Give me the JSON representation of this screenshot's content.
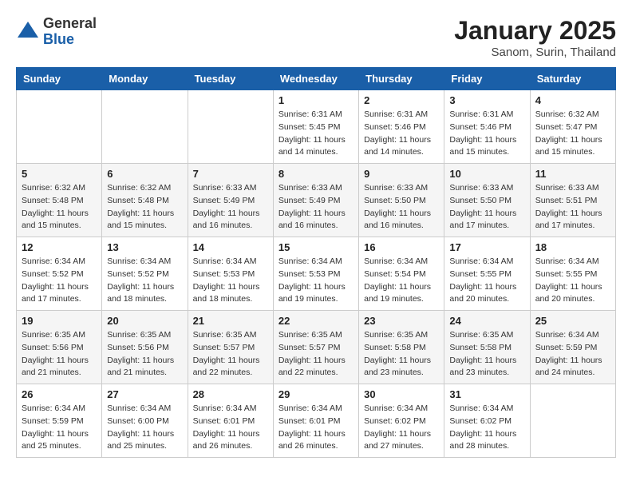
{
  "logo": {
    "general": "General",
    "blue": "Blue"
  },
  "header": {
    "month": "January 2025",
    "location": "Sanom, Surin, Thailand"
  },
  "weekdays": [
    "Sunday",
    "Monday",
    "Tuesday",
    "Wednesday",
    "Thursday",
    "Friday",
    "Saturday"
  ],
  "weeks": [
    [
      {
        "day": "",
        "info": ""
      },
      {
        "day": "",
        "info": ""
      },
      {
        "day": "",
        "info": ""
      },
      {
        "day": "1",
        "info": "Sunrise: 6:31 AM\nSunset: 5:45 PM\nDaylight: 11 hours and 14 minutes."
      },
      {
        "day": "2",
        "info": "Sunrise: 6:31 AM\nSunset: 5:46 PM\nDaylight: 11 hours and 14 minutes."
      },
      {
        "day": "3",
        "info": "Sunrise: 6:31 AM\nSunset: 5:46 PM\nDaylight: 11 hours and 15 minutes."
      },
      {
        "day": "4",
        "info": "Sunrise: 6:32 AM\nSunset: 5:47 PM\nDaylight: 11 hours and 15 minutes."
      }
    ],
    [
      {
        "day": "5",
        "info": "Sunrise: 6:32 AM\nSunset: 5:48 PM\nDaylight: 11 hours and 15 minutes."
      },
      {
        "day": "6",
        "info": "Sunrise: 6:32 AM\nSunset: 5:48 PM\nDaylight: 11 hours and 15 minutes."
      },
      {
        "day": "7",
        "info": "Sunrise: 6:33 AM\nSunset: 5:49 PM\nDaylight: 11 hours and 16 minutes."
      },
      {
        "day": "8",
        "info": "Sunrise: 6:33 AM\nSunset: 5:49 PM\nDaylight: 11 hours and 16 minutes."
      },
      {
        "day": "9",
        "info": "Sunrise: 6:33 AM\nSunset: 5:50 PM\nDaylight: 11 hours and 16 minutes."
      },
      {
        "day": "10",
        "info": "Sunrise: 6:33 AM\nSunset: 5:50 PM\nDaylight: 11 hours and 17 minutes."
      },
      {
        "day": "11",
        "info": "Sunrise: 6:33 AM\nSunset: 5:51 PM\nDaylight: 11 hours and 17 minutes."
      }
    ],
    [
      {
        "day": "12",
        "info": "Sunrise: 6:34 AM\nSunset: 5:52 PM\nDaylight: 11 hours and 17 minutes."
      },
      {
        "day": "13",
        "info": "Sunrise: 6:34 AM\nSunset: 5:52 PM\nDaylight: 11 hours and 18 minutes."
      },
      {
        "day": "14",
        "info": "Sunrise: 6:34 AM\nSunset: 5:53 PM\nDaylight: 11 hours and 18 minutes."
      },
      {
        "day": "15",
        "info": "Sunrise: 6:34 AM\nSunset: 5:53 PM\nDaylight: 11 hours and 19 minutes."
      },
      {
        "day": "16",
        "info": "Sunrise: 6:34 AM\nSunset: 5:54 PM\nDaylight: 11 hours and 19 minutes."
      },
      {
        "day": "17",
        "info": "Sunrise: 6:34 AM\nSunset: 5:55 PM\nDaylight: 11 hours and 20 minutes."
      },
      {
        "day": "18",
        "info": "Sunrise: 6:34 AM\nSunset: 5:55 PM\nDaylight: 11 hours and 20 minutes."
      }
    ],
    [
      {
        "day": "19",
        "info": "Sunrise: 6:35 AM\nSunset: 5:56 PM\nDaylight: 11 hours and 21 minutes."
      },
      {
        "day": "20",
        "info": "Sunrise: 6:35 AM\nSunset: 5:56 PM\nDaylight: 11 hours and 21 minutes."
      },
      {
        "day": "21",
        "info": "Sunrise: 6:35 AM\nSunset: 5:57 PM\nDaylight: 11 hours and 22 minutes."
      },
      {
        "day": "22",
        "info": "Sunrise: 6:35 AM\nSunset: 5:57 PM\nDaylight: 11 hours and 22 minutes."
      },
      {
        "day": "23",
        "info": "Sunrise: 6:35 AM\nSunset: 5:58 PM\nDaylight: 11 hours and 23 minutes."
      },
      {
        "day": "24",
        "info": "Sunrise: 6:35 AM\nSunset: 5:58 PM\nDaylight: 11 hours and 23 minutes."
      },
      {
        "day": "25",
        "info": "Sunrise: 6:34 AM\nSunset: 5:59 PM\nDaylight: 11 hours and 24 minutes."
      }
    ],
    [
      {
        "day": "26",
        "info": "Sunrise: 6:34 AM\nSunset: 5:59 PM\nDaylight: 11 hours and 25 minutes."
      },
      {
        "day": "27",
        "info": "Sunrise: 6:34 AM\nSunset: 6:00 PM\nDaylight: 11 hours and 25 minutes."
      },
      {
        "day": "28",
        "info": "Sunrise: 6:34 AM\nSunset: 6:01 PM\nDaylight: 11 hours and 26 minutes."
      },
      {
        "day": "29",
        "info": "Sunrise: 6:34 AM\nSunset: 6:01 PM\nDaylight: 11 hours and 26 minutes."
      },
      {
        "day": "30",
        "info": "Sunrise: 6:34 AM\nSunset: 6:02 PM\nDaylight: 11 hours and 27 minutes."
      },
      {
        "day": "31",
        "info": "Sunrise: 6:34 AM\nSunset: 6:02 PM\nDaylight: 11 hours and 28 minutes."
      },
      {
        "day": "",
        "info": ""
      }
    ]
  ]
}
